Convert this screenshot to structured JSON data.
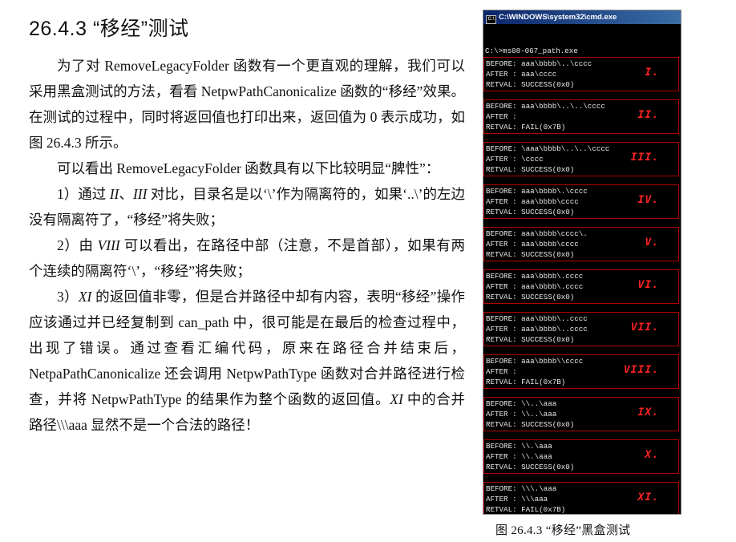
{
  "title": "26.4.3 “移经”测试",
  "paragraphs": [
    "为了对 RemoveLegacyFolder 函数有一个更直观的理解，我们可以采用黑盒测试的方法，看看 NetpwPathCanonicalize 函数的“移经”效果。在测试的过程中，同时将返回值也打印出来，返回值为 0 表示成功，如图 26.4.3 所示。",
    "可以看出 RemoveLegacyFolder 函数具有以下比较明显“脾性”："
  ],
  "list": {
    "item1": {
      "a": "1）通过 ",
      "b": "II",
      "c": "、",
      "d": "III",
      "e": " 对比，目录名是以‘\\’作为隔离符的，如果‘..\\’的左边没有隔离符了，“移经”将失败；"
    },
    "item2": {
      "a": "2）由 ",
      "b": "VIII",
      "c": " 可以看出，在路径中部（注意，不是首部），如果有两个连续的隔离符‘\\’，“移经”将失败；"
    },
    "item3": {
      "a": "3）",
      "b": "XI",
      "c": " 的返回值非零，但是合并路径中却有内容，表明“移经”操作应该通过并已经复制到 can_path 中，很可能是在最后的检查过程中，出现了错误。通过查看汇编代码，原来在路径合并结束后，NetpaPathCanonicalize 还会调用 NetpwPathType 函数对合并路径进行检查，并将 NetpwPathType 的结果作为整个函数的返回值。",
      "d": "XI",
      "e": " 中的合并路径\\\\\\aaa 显然不是一个合法的路径！"
    }
  },
  "cmd": {
    "icon": "cmd-icon",
    "title": "C:\\WINDOWS\\system32\\cmd.exe",
    "prompt": "C:\\>ms08-067_path.exe",
    "blocks": [
      {
        "before": "BEFORE: aaa\\bbbb\\..\\cccc",
        "after": "AFTER : aaa\\cccc",
        "retval": "RETVAL: SUCCESS(0x0)",
        "label": "I."
      },
      {
        "before": "BEFORE: aaa\\bbbb\\..\\..\\cccc",
        "after": "AFTER :",
        "retval": "RETVAL: FAIL(0x7B)",
        "label": "II."
      },
      {
        "before": "BEFORE: \\aaa\\bbbb\\..\\..\\cccc",
        "after": "AFTER : \\cccc",
        "retval": "RETVAL: SUCCESS(0x0)",
        "label": "III."
      },
      {
        "before": "BEFORE: aaa\\bbbb\\.\\cccc",
        "after": "AFTER : aaa\\bbbb\\cccc",
        "retval": "RETVAL: SUCCESS(0x0)",
        "label": "IV."
      },
      {
        "before": "BEFORE: aaa\\bbbb\\cccc\\.",
        "after": "AFTER : aaa\\bbbb\\cccc",
        "retval": "RETVAL: SUCCESS(0x0)",
        "label": "V."
      },
      {
        "before": "BEFORE: aaa\\bbbb\\.cccc",
        "after": "AFTER : aaa\\bbbb\\.cccc",
        "retval": "RETVAL: SUCCESS(0x0)",
        "label": "VI."
      },
      {
        "before": "BEFORE: aaa\\bbbb\\..cccc",
        "after": "AFTER : aaa\\bbbb\\..cccc",
        "retval": "RETVAL: SUCCESS(0x0)",
        "label": "VII."
      },
      {
        "before": "BEFORE: aaa\\bbbb\\\\cccc",
        "after": "AFTER :",
        "retval": "RETVAL: FAIL(0x7B)",
        "label": "VIII."
      },
      {
        "before": "BEFORE: \\\\..\\aaa",
        "after": "AFTER : \\\\..\\aaa",
        "retval": "RETVAL: SUCCESS(0x0)",
        "label": "IX."
      },
      {
        "before": "BEFORE: \\\\.\\aaa",
        "after": "AFTER : \\\\.\\aaa",
        "retval": "RETVAL: SUCCESS(0x0)",
        "label": "X."
      },
      {
        "before": "BEFORE: \\\\\\.\\aaa",
        "after": "AFTER : \\\\\\aaa",
        "retval": "RETVAL: FAIL(0x7B)",
        "label": "XI."
      }
    ]
  },
  "caption": "图 26.4.3 “移经”黑盒测试",
  "colors": {
    "label_red": "#ff2222",
    "border_red": "#b00000",
    "titlebar_blue": "#0a246a"
  }
}
